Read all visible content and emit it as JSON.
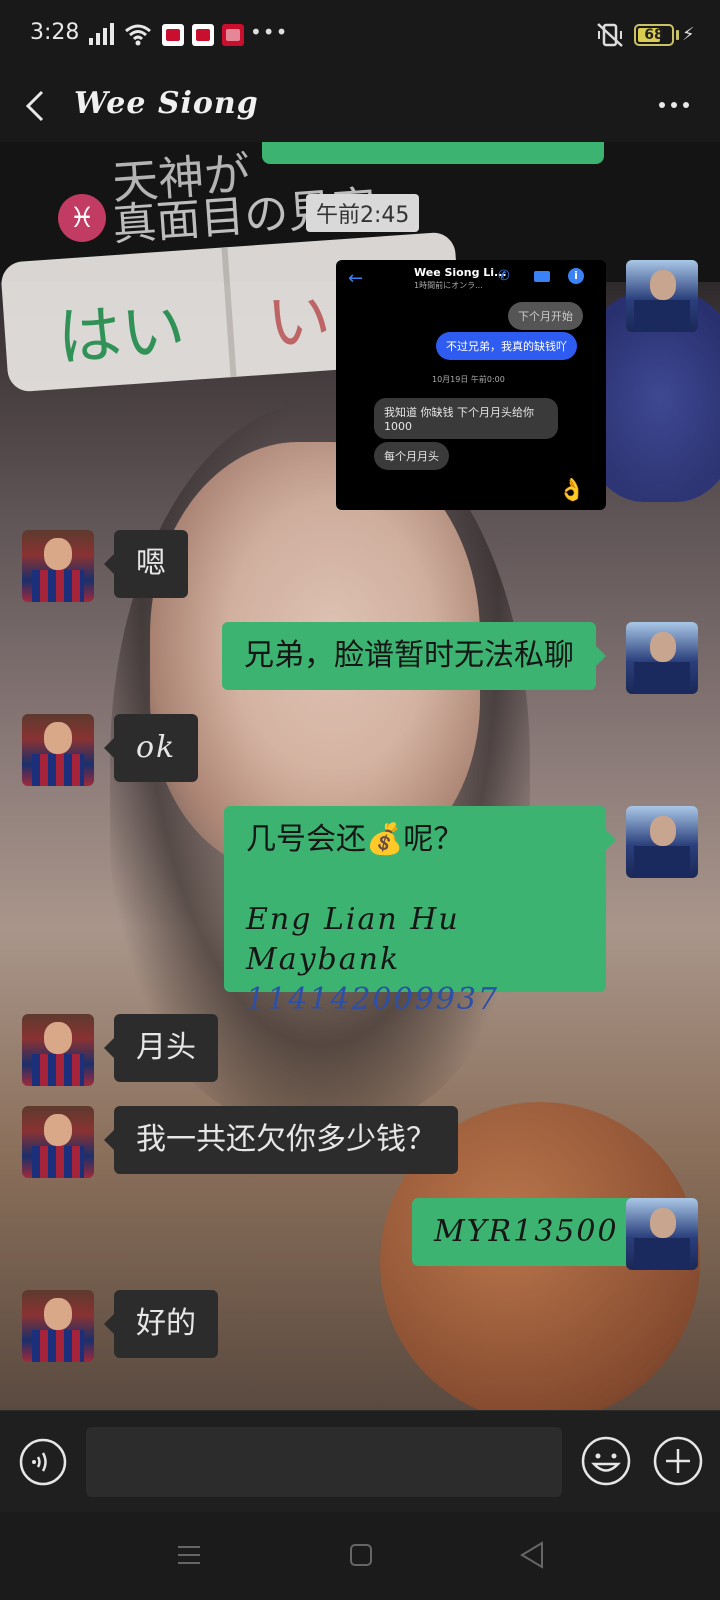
{
  "status_bar": {
    "time": "3:28",
    "battery": "68",
    "battery_level": 0.68,
    "dots": "•••",
    "bolt": "⚡"
  },
  "header": {
    "title": "Wee Siong"
  },
  "wallpaper": {
    "hai": "はい",
    "ii": "いい",
    "line1": "天神が",
    "line2": "真面目の見実",
    "symbol": "♓"
  },
  "timestamp": "午前2:45",
  "screenshot": {
    "back": "←",
    "name": "Wee Siong Li...",
    "subtitle": "1時間前にオンラ...",
    "call": "✆",
    "info": "i",
    "msg1": "下个月开始",
    "msg2": "不过兄弟，我真的缺钱吖",
    "date": "10月19日 午前0:00",
    "msg3a": "我知道 你缺钱 下个月月头给你",
    "msg3b": "1000",
    "msg4": "每个月月头",
    "emoji": "👌"
  },
  "messages": [
    {
      "from": "other",
      "text": "嗯"
    },
    {
      "from": "me",
      "text": "兄弟，脸谱暂时无法私聊"
    },
    {
      "from": "other",
      "text": "ok"
    },
    {
      "from": "me",
      "line1": "几号会还💰呢？",
      "line2": "Eng Lian Hu",
      "bank": "Maybank",
      "account": "114142009937"
    },
    {
      "from": "other",
      "text": "月头"
    },
    {
      "from": "other",
      "text": "我一共还欠你多少钱？"
    },
    {
      "from": "me",
      "text": "MYR13500"
    },
    {
      "from": "other",
      "text": "好的"
    }
  ],
  "input": {
    "value": "",
    "placeholder": ""
  },
  "colors": {
    "outgoing_bubble": "#3cb371",
    "incoming_bubble": "#2c2c2c",
    "header_bg": "#191919",
    "account_number": "#2c4fa8"
  }
}
